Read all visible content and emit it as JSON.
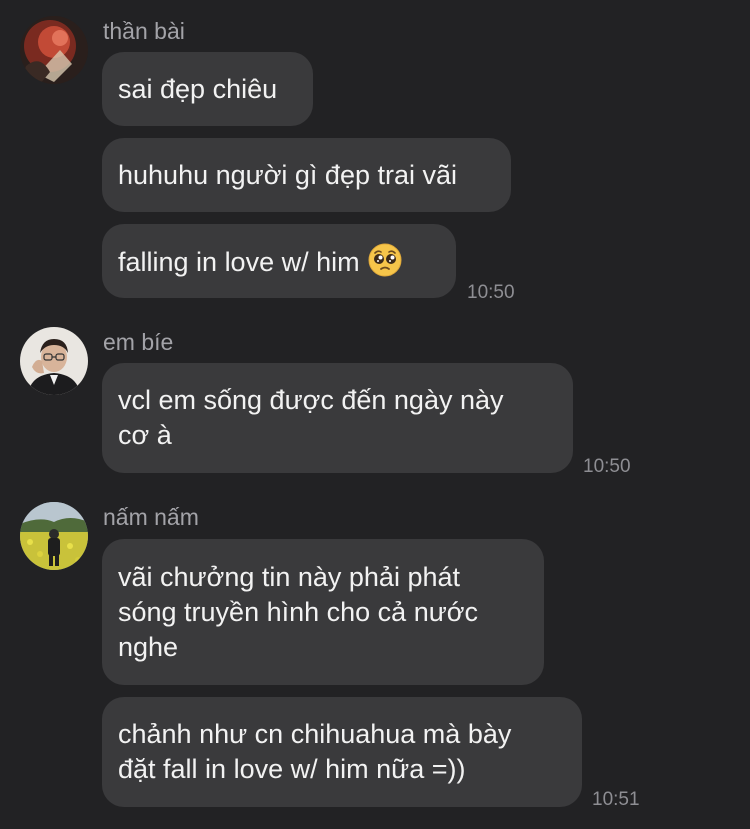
{
  "messages": [
    {
      "sender": "thần bài",
      "avatar": "red-abstract-photo-avatar",
      "bubbles": [
        {
          "lines": [
            "sai đẹp chiêu"
          ]
        },
        {
          "lines": [
            "huhuhu người gì đẹp trai vãi"
          ]
        },
        {
          "lines": [
            "falling in love w/ him"
          ],
          "emoji": "pleading-face-emoji"
        }
      ],
      "time": "10:50"
    },
    {
      "sender": "em bíe",
      "avatar": "man-with-glasses-avatar",
      "bubbles": [
        {
          "lines": [
            "vcl em sống được đến ngày này",
            "cơ à"
          ]
        }
      ],
      "time": "10:50"
    },
    {
      "sender": "nấm nấm",
      "avatar": "person-in-flower-field-avatar",
      "bubbles": [
        {
          "lines": [
            "vãi chưởng tin này phải phát",
            "sóng truyền hình cho cả nước",
            "nghe"
          ]
        },
        {
          "lines": [
            "chảnh như cn chihuahua mà bày",
            "đặt fall in love w/ him nữa =))"
          ]
        }
      ],
      "time": "10:51"
    }
  ]
}
